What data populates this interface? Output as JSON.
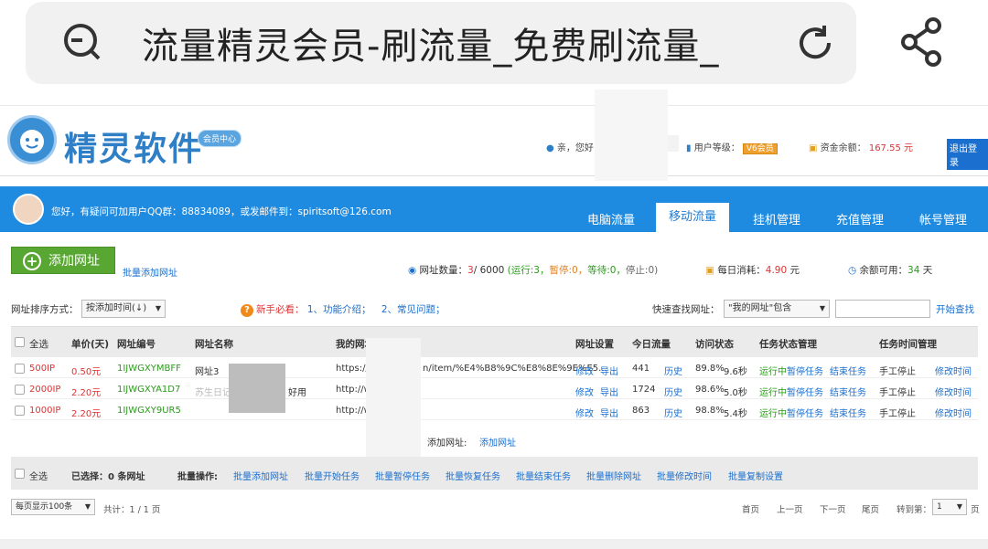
{
  "browser": {
    "url_title": "流量精灵会员-刷流量_免费刷流量_",
    "left_icon": "search-refresh-icon",
    "reload_icon": "reload-icon",
    "share_icon": "share-icon"
  },
  "header": {
    "logo_text": "精灵软件",
    "logo_badge": "会员中心",
    "greeting": "亲，您好",
    "level_label": "用户等级：",
    "level_badge": "V6会员",
    "balance_label": "资金余额：",
    "balance_value": "167.55 元",
    "logout": "退出登录"
  },
  "nav": {
    "message": "您好，有疑问可加用户QQ群：88834089，或发邮件到：spiritsoft@126.com",
    "tabs": [
      "电脑流量",
      "移动流量",
      "挂机管理",
      "充值管理",
      "帐号管理"
    ],
    "active_tab": "移动流量"
  },
  "toolbar": {
    "add_url": "添加网址",
    "batch_add": "批量添加网址",
    "url_count_label": "网址数量：",
    "url_count_value": "3",
    "url_count_total": "/ 6000",
    "url_status_open": "(运行:3，",
    "url_paused": "暂停:0，",
    "url_waiting": "等待:0，",
    "url_stopped": "停止:0)",
    "daily_cost_label": "每日消耗：",
    "daily_cost_value": "4.90",
    "daily_cost_unit": "元",
    "remaining_label": "余额可用：",
    "remaining_value": "34",
    "remaining_unit": "天"
  },
  "filter": {
    "sort_label": "网址排序方式：",
    "sort_value": "按添加时间(↓)",
    "newbie_label": "新手必看：",
    "newbie_link1": "1、功能介绍；",
    "newbie_link2": "2、常见问题；",
    "search_label": "快速查找网址：",
    "search_scope": "\"我的网址\"包含",
    "search_button": "开始查找"
  },
  "table": {
    "headers": {
      "select_all": "全选",
      "price": "单价(天)",
      "code": "网址编号",
      "name": "网址名称",
      "my_url": "我的网址",
      "settings": "网址设置",
      "today": "今日流量",
      "visit": "访问状态",
      "task_state": "任务状态管理",
      "task_time": "任务时间管理"
    },
    "rows": [
      {
        "ip": "500IP",
        "price": "0.50元",
        "code": "1IJWGXYMBFF",
        "name": "网址3",
        "url_a": "https://",
        "url_b": "n/item/%E4%B8%9C%E8%8E%9E%E5...",
        "edit": "修改",
        "export": "导出",
        "today": "441",
        "history": "历史",
        "rate": "89.8%",
        "time": "9.6秒",
        "running": "运行中",
        "pause": "暂停任务",
        "end": "结束任务",
        "manual": "手工停止",
        "modify_time": "修改时间"
      },
      {
        "ip": "2000IP",
        "price": "2.20元",
        "code": "1IJWGXYA1D7",
        "name": "苏生日记",
        "name_b": "好用",
        "url_a": "http://w",
        "url_b": "",
        "edit": "修改",
        "export": "导出",
        "today": "1724",
        "history": "历史",
        "rate": "98.6%",
        "time": "5.0秒",
        "running": "运行中",
        "pause": "暂停任务",
        "end": "结束任务",
        "manual": "手工停止",
        "modify_time": "修改时间"
      },
      {
        "ip": "1000IP",
        "price": "2.20元",
        "code": "1IJWGXY9UR5",
        "name": "",
        "url_a": "http://w",
        "url_b": "",
        "edit": "修改",
        "export": "导出",
        "today": "863",
        "history": "历史",
        "rate": "98.8%",
        "time": "5.4秒",
        "running": "运行中",
        "pause": "暂停任务",
        "end": "结束任务",
        "manual": "手工停止",
        "modify_time": "修改时间"
      }
    ],
    "add_row_label": "添加网址:",
    "add_row_link": "添加网址"
  },
  "footer_bar": {
    "select_all": "全选",
    "selected": "已选择：",
    "selected_count": "0 条网址",
    "batch_ops": "批量操作:",
    "ops": [
      "批量添加网址",
      "批量开始任务",
      "批量暂停任务",
      "批量恢复任务",
      "批量结束任务",
      "批量删除网址",
      "批量修改时间",
      "批量复制设置"
    ]
  },
  "pager": {
    "per_page": "每页显示100条",
    "total": "共计：1 / 1 页",
    "first": "首页",
    "prev": "上一页",
    "next": "下一页",
    "last": "尾页",
    "goto_label": "转到第：",
    "goto_value": "1",
    "page_unit": "页"
  },
  "colors": {
    "nav_blue": "#1e8be0",
    "add_green": "#58a732",
    "link_blue": "#1a6fcf",
    "price_red": "#d33333",
    "code_green": "#2a9a1a"
  }
}
